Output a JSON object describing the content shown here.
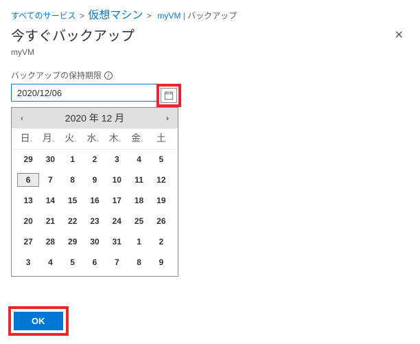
{
  "breadcrumb": {
    "all_services": "すべてのサービス",
    "vm_list": "仮想マシン",
    "vm_name": "myVM",
    "page": "バックアップ",
    "sep": ">"
  },
  "header": {
    "title": "今すぐバックアップ",
    "close": "✕"
  },
  "subtitle": "myVM",
  "field": {
    "label": "バックアップの保持期限",
    "info": "i",
    "value": "2020/12/06"
  },
  "calendar": {
    "prev": "‹",
    "next": "›",
    "title": "2020 年 12 月",
    "dow": [
      "日",
      "月",
      "火",
      "水",
      "木",
      "金",
      "土"
    ],
    "comma": "、",
    "days": [
      {
        "n": "29"
      },
      {
        "n": "30"
      },
      {
        "n": "1"
      },
      {
        "n": "2"
      },
      {
        "n": "3"
      },
      {
        "n": "4"
      },
      {
        "n": "5"
      },
      {
        "n": "6",
        "sel": true
      },
      {
        "n": "7"
      },
      {
        "n": "8"
      },
      {
        "n": "9"
      },
      {
        "n": "10"
      },
      {
        "n": "11"
      },
      {
        "n": "12"
      },
      {
        "n": "13"
      },
      {
        "n": "14"
      },
      {
        "n": "15"
      },
      {
        "n": "16"
      },
      {
        "n": "17"
      },
      {
        "n": "18"
      },
      {
        "n": "19"
      },
      {
        "n": "20"
      },
      {
        "n": "21"
      },
      {
        "n": "22"
      },
      {
        "n": "23"
      },
      {
        "n": "24"
      },
      {
        "n": "25"
      },
      {
        "n": "26"
      },
      {
        "n": "27"
      },
      {
        "n": "28"
      },
      {
        "n": "29"
      },
      {
        "n": "30"
      },
      {
        "n": "31"
      },
      {
        "n": "1"
      },
      {
        "n": "2"
      },
      {
        "n": "3"
      },
      {
        "n": "4"
      },
      {
        "n": "5"
      },
      {
        "n": "6"
      },
      {
        "n": "7"
      },
      {
        "n": "8"
      },
      {
        "n": "9"
      }
    ]
  },
  "footer": {
    "ok": "OK"
  }
}
